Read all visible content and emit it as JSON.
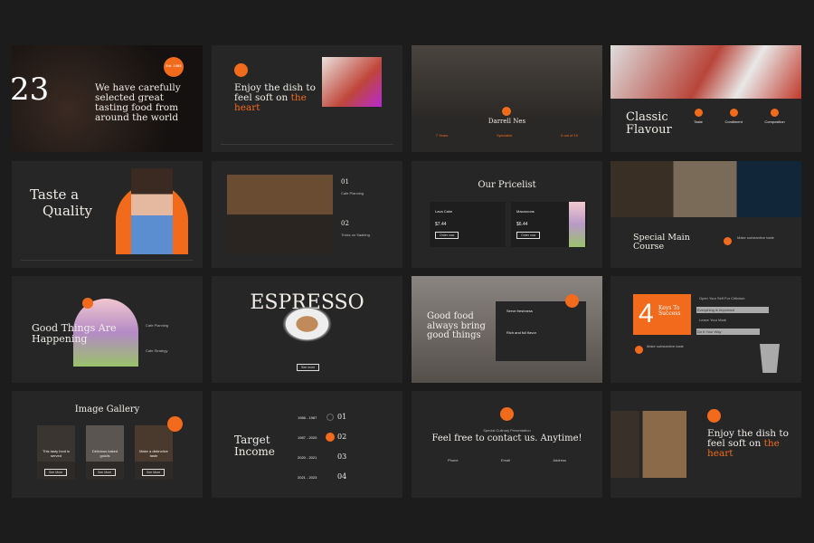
{
  "accent": "#f26a1b",
  "slides": {
    "s1": {
      "badge": "Est. 1985",
      "numeral": "23",
      "text": "We have carefully selected great tasting food from around the world"
    },
    "s2": {
      "title": "Enjoy the dish to feel soft on",
      "highlight": "the heart"
    },
    "s3": {
      "name": "Darrell Nes",
      "stats": [
        "7 Years",
        "Specialist",
        "5 out of 10"
      ]
    },
    "s4": {
      "title": "Classic Flavour",
      "features": [
        "Taste",
        "Condiment",
        "Composition"
      ]
    },
    "s5": {
      "line1": "Taste a",
      "line2": "Quality"
    },
    "s6": {
      "items": [
        {
          "num": "01",
          "label": "Cafe Planning"
        },
        {
          "num": "02",
          "label": "Tricks on Saabing"
        }
      ]
    },
    "s7": {
      "title": "Our Pricelist",
      "items": [
        {
          "name": "Lava Cake",
          "price": "$7.44",
          "button": "Order now"
        },
        {
          "name": "Macaroons",
          "price": "$6.44",
          "button": "Order now"
        }
      ]
    },
    "s8": {
      "title": "Special Main Course",
      "feature": "Make substantive taste"
    },
    "s9": {
      "title": "Good Things Are Happening",
      "items": [
        "Cafe Planning",
        "Cafe Strategy"
      ]
    },
    "s10": {
      "title": "ESPRESSO",
      "button": "See more"
    },
    "s11": {
      "title": "Good food always bring good things",
      "items": [
        "Serve freshness",
        "Rich and full flavor"
      ]
    },
    "s12": {
      "number": "4",
      "title": "Keys To Success",
      "keys": [
        "Open Your Self For Criticism",
        "Everything is Important",
        "Leave Your Mark",
        "Do It Your Way"
      ],
      "feature": "Make substantive taste"
    },
    "s13": {
      "title": "Image Gallery",
      "cards": [
        {
          "caption": "This tasty food is served",
          "button": "See More"
        },
        {
          "caption": "Delicious baked goods",
          "button": "See More"
        },
        {
          "caption": "Make a distinctive taste",
          "button": "See More"
        }
      ]
    },
    "s14": {
      "title": "Target Income",
      "rows": [
        {
          "years": "1986 - 1987",
          "num": "01"
        },
        {
          "years": "1987 - 2020",
          "num": "02"
        },
        {
          "years": "2020 - 2021",
          "num": "03"
        },
        {
          "years": "2021 - 2023",
          "num": "04"
        }
      ]
    },
    "s15": {
      "subtitle": "Special Culinary Presentation",
      "title": "Feel free to contact us. Anytime!",
      "contacts": [
        "Phone",
        "Email",
        "Address"
      ]
    },
    "s16": {
      "title": "Enjoy the dish to feel soft on",
      "highlight": "the heart"
    }
  }
}
